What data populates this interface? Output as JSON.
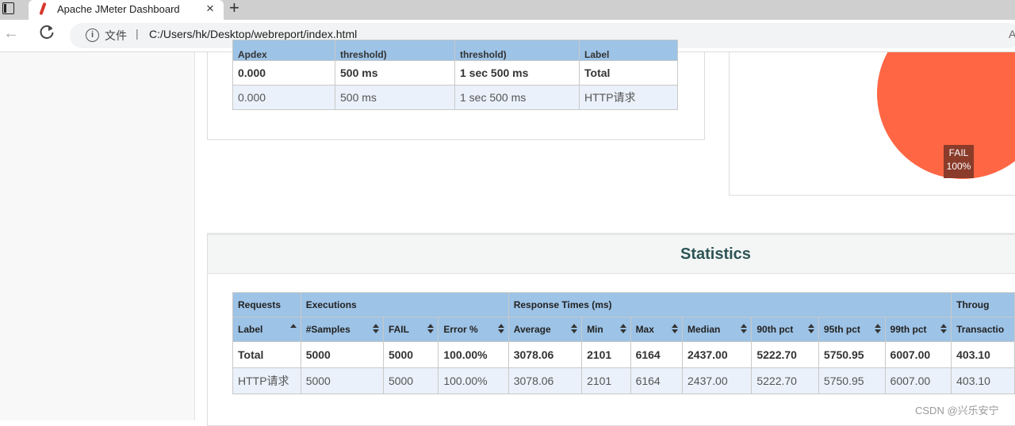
{
  "browser": {
    "tab_title": "Apache JMeter Dashboard",
    "tab_close": "×",
    "new_tab": "+",
    "back": "←",
    "info": "i",
    "scheme": "文件",
    "separator": "|",
    "url": "C:/Users/hk/Desktop/webreport/index.html",
    "edge_text": "A"
  },
  "apdex": {
    "headers": [
      "Apdex",
      "threshold)",
      "threshold)",
      "Label"
    ],
    "rows": [
      [
        "0.000",
        "500 ms",
        "1 sec 500 ms",
        "Total"
      ],
      [
        "0.000",
        "500 ms",
        "1 sec 500 ms",
        "HTTP请求"
      ]
    ]
  },
  "pie": {
    "label": "FAIL",
    "percent": "100%",
    "color": "#ff6644"
  },
  "statistics": {
    "title": "Statistics",
    "groups": [
      "Requests",
      "Executions",
      "Response Times (ms)",
      "Throug"
    ],
    "columns": [
      "Label",
      "#Samples",
      "FAIL",
      "Error %",
      "Average",
      "Min",
      "Max",
      "Median",
      "90th pct",
      "95th pct",
      "99th pct",
      "Transactio"
    ],
    "rows": [
      [
        "Total",
        "5000",
        "5000",
        "100.00%",
        "3078.06",
        "2101",
        "6164",
        "2437.00",
        "5222.70",
        "5750.95",
        "6007.00",
        "403.10"
      ],
      [
        "HTTP请求",
        "5000",
        "5000",
        "100.00%",
        "3078.06",
        "2101",
        "6164",
        "2437.00",
        "5222.70",
        "5750.95",
        "6007.00",
        "403.10"
      ]
    ]
  },
  "watermark": "CSDN @兴乐安宁",
  "colors": {
    "header_blue": "#9dc3e6",
    "row_alt": "#eaf1fa",
    "title_teal": "#2d5455"
  }
}
